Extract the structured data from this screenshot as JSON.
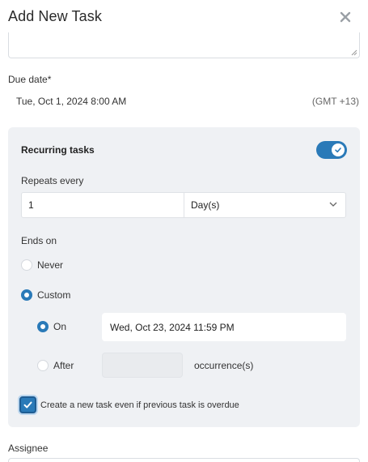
{
  "dialog": {
    "title": "Add New Task",
    "close_icon": "close-icon"
  },
  "due": {
    "label": "Due date*",
    "value": "Tue, Oct 1, 2024 8:00 AM",
    "timezone": "(GMT +13)"
  },
  "recurring": {
    "label": "Recurring tasks",
    "enabled": true,
    "repeats_label": "Repeats every",
    "interval_value": "1",
    "interval_unit": "Day(s)",
    "ends_label": "Ends on",
    "options": {
      "never": "Never",
      "custom": "Custom"
    },
    "selected_option": "custom",
    "sub_options": {
      "on": "On",
      "after": "After"
    },
    "selected_sub_option": "on",
    "on_date": "Wed, Oct 23, 2024 11:59 PM",
    "after_value": "",
    "occurrence_label": "occurrence(s)",
    "overdue_checkbox_label": "Create a new task even if previous task is overdue",
    "overdue_checked": true
  },
  "assignee": {
    "label": "Assignee"
  },
  "colors": {
    "accent": "#2a7ab8",
    "panel": "#eff1f4"
  }
}
